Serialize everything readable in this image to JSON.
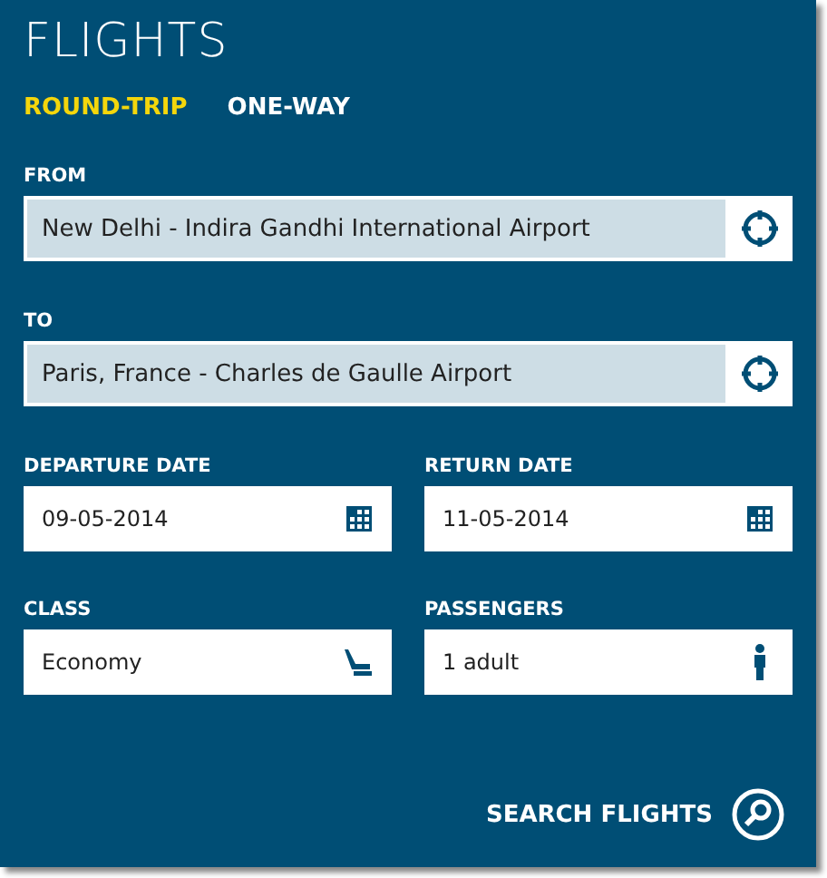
{
  "title": "FLIGHTS",
  "tabs": [
    {
      "label": "ROUND-TRIP",
      "selected": true
    },
    {
      "label": "ONE-WAY",
      "selected": false
    }
  ],
  "locations": [
    {
      "label": "FROM",
      "value": "New Delhi - Indira Gandhi International Airport"
    },
    {
      "label": "TO",
      "value": "Paris, France - Charles de Gaulle Airport"
    }
  ],
  "pairs": [
    [
      {
        "label": "DEPARTURE DATE",
        "value": "09-05-2014",
        "kind": "date"
      },
      {
        "label": "RETURN DATE",
        "value": "11-05-2014",
        "kind": "date"
      }
    ],
    [
      {
        "label": "CLASS",
        "value": "Economy",
        "kind": "seat"
      },
      {
        "label": "PASSENGERS",
        "value": "1 adult",
        "kind": "person"
      }
    ]
  ],
  "search_button": "SEARCH FLIGHTS"
}
